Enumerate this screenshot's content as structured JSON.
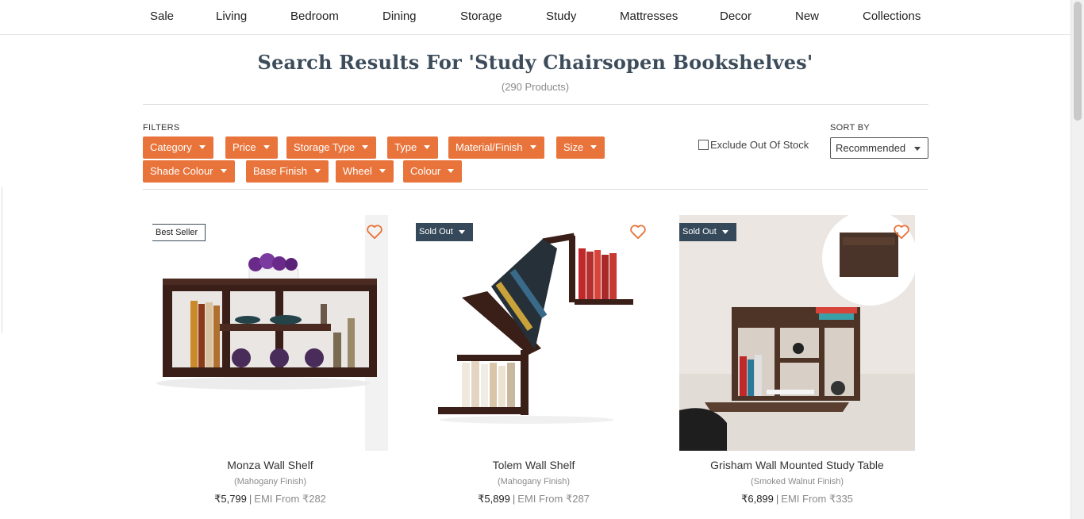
{
  "nav": {
    "items": [
      "Sale",
      "Living",
      "Bedroom",
      "Dining",
      "Storage",
      "Study",
      "Mattresses",
      "Decor",
      "New",
      "Collections"
    ]
  },
  "search": {
    "title": "Search Results For 'Study Chairsopen Bookshelves'",
    "count": "(290 Products)"
  },
  "filters": {
    "label": "FILTERS",
    "chips": [
      "Category",
      "Price",
      "Storage Type",
      "Type",
      "Material/Finish",
      "Size",
      "Shade Colour",
      "Base Finish",
      "Wheel",
      "Colour"
    ],
    "exclude_label": "Exclude Out Of Stock",
    "exclude_checked": false
  },
  "sort": {
    "label": "SORT BY",
    "selected": "Recommended"
  },
  "colors": {
    "accent": "#e8743b",
    "title": "#3c4c5a",
    "sold_badge": "#35495a"
  },
  "products": [
    {
      "name": "Monza Wall Shelf",
      "finish": "(Mahogany Finish)",
      "price": "₹5,799",
      "emi": "EMI From ₹282",
      "badge": "Best Seller",
      "badge_type": "best"
    },
    {
      "name": "Tolem Wall Shelf",
      "finish": "(Mahogany Finish)",
      "price": "₹5,899",
      "emi": "EMI From ₹287",
      "badge": "Sold Out",
      "badge_type": "sold"
    },
    {
      "name": "Grisham Wall Mounted Study Table",
      "finish": "(Smoked Walnut Finish)",
      "price": "₹6,899",
      "emi": "EMI From ₹335",
      "badge": "Sold Out",
      "badge_type": "sold"
    }
  ]
}
